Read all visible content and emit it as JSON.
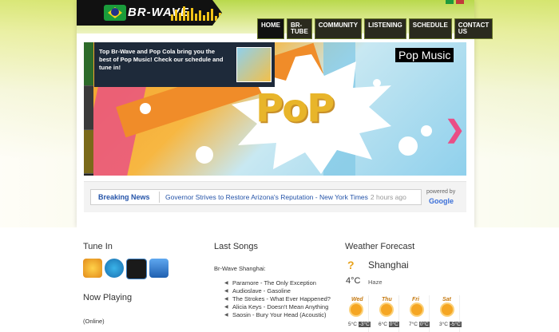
{
  "header": {
    "logo_text": "BR-WAVE",
    "languages": [
      "pt",
      "en"
    ],
    "nav": [
      {
        "label": "HOME",
        "active": true
      },
      {
        "label": "BR-TUBE"
      },
      {
        "label": "COMMUNITY"
      },
      {
        "label": "LISTENING"
      },
      {
        "label": "SCHEDULE"
      },
      {
        "label": "CONTACT US"
      }
    ]
  },
  "banner": {
    "promo_text": "Top Br-Wave and Pop Cola bring you the best of Pop Music! Check our schedule and tune in!",
    "tag": "Pop Music",
    "art_text": "PoP"
  },
  "ticker": {
    "label": "Breaking News",
    "headline": "Governor Strives to Restore Arizona's Reputation - New York Times",
    "time": "2 hours ago",
    "powered_by": "powered by",
    "provider": "Google"
  },
  "tune_in": {
    "title": "Tune In",
    "players": [
      "winamp-icon",
      "windows-media-player-icon",
      "real-player-icon",
      "itunes-icon"
    ]
  },
  "now_playing": {
    "title": "Now Playing",
    "status": "(Online)"
  },
  "last_songs": {
    "title": "Last Songs",
    "station": "Br-Wave Shanghai:",
    "items": [
      "Paramore - The Only Exception",
      "Audioslave - Gasoline",
      "The Strokes - What Ever Happened?",
      "Alicia Keys - Doesn't Mean Anything",
      "Saosin - Bury Your Head (Acoustic)"
    ]
  },
  "weather": {
    "title": "Weather Forecast",
    "city": "Shanghai",
    "current_temp": "4°C",
    "condition": "Haze",
    "days": [
      {
        "name": "Wed",
        "high": "5°C",
        "low": "-3°C"
      },
      {
        "name": "Thu",
        "high": "6°C",
        "low": "0°C"
      },
      {
        "name": "Fri",
        "high": "7°C",
        "low": "0°C"
      },
      {
        "name": "Sat",
        "high": "3°C",
        "low": "-5°C"
      }
    ]
  }
}
